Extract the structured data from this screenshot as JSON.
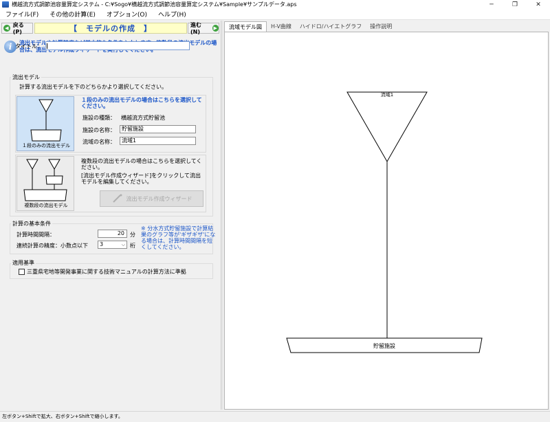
{
  "window": {
    "title": "横越流方式調節池容量算定システム - C:¥Sogo¥横越流方式調節池容量算定システム¥Sample¥サンプルデータ.aps",
    "minimize": "─",
    "restore": "❐",
    "close": "✕"
  },
  "menu": {
    "file": "ファイル(F)",
    "other_calc": "その他の計算(E)",
    "options": "オプション(O)",
    "help": "ヘルプ(H)"
  },
  "nav": {
    "back_icon": "◀",
    "back": "戻る(P)",
    "page_title": "【　モデルの作成　】",
    "next": "進む(N)",
    "next_icon": "▶"
  },
  "info": {
    "icon_glyph": "i",
    "text": "流出モデルや計算精度など基本的な条件を入力します。複数段の流出モデルの場合は、流出モデル作成ウィザードを実行してください。"
  },
  "title_field": {
    "label": "タイトル：",
    "value": ""
  },
  "outflow_model": {
    "group_label": "流出モデル",
    "instruction": "計算する流出モデルを下のどちらかより選択してください。",
    "single": {
      "caption": "１段のみの流出モデル",
      "heading": "１段のみの流出モデルの場合はこちらを選択してください。",
      "facility_type_label": "施設の種類：",
      "facility_type_value": "横越流方式貯留池",
      "facility_name_label": "施設の名称：",
      "facility_name_value": "貯留施設",
      "basin_name_label": "流域の名称：",
      "basin_name_value": "流域1"
    },
    "multi": {
      "caption": "複数段の流出モデル",
      "text1": "複数段の流出モデルの場合はこちらを選択してください。",
      "text2": "[流出モデル作成ウィザード]をクリックして流出モデルを編集してください。",
      "wizard_button": "流出モデル作成ウィザード"
    }
  },
  "calc_conditions": {
    "group_label": "計算の基本条件",
    "interval_label": "計算時間間隔：",
    "interval_value": "20",
    "interval_unit": "分",
    "precision_label": "連続計算の精度：小数点以下",
    "precision_value": "3",
    "precision_unit": "桁",
    "note": "※ 分水方式貯留施設で計算結果のグラフ等が'ギザギザ'になる場合は、計算時間間隔を短くしてください。"
  },
  "standard": {
    "group_label": "適用基準",
    "checkbox_label": "三重県宅地等開発事業に関する技術マニュアルの計算方法に準拠",
    "checked": false
  },
  "tabs": [
    "流域モデル図",
    "H-V曲線",
    "ハイドロ/ハイエトグラフ",
    "操作説明"
  ],
  "diagram": {
    "basin_label": "流域1",
    "facility_label": "貯留施設"
  },
  "status": "左ボタン+Shiftで拡大、右ボタン+Shiftで縮小します。"
}
